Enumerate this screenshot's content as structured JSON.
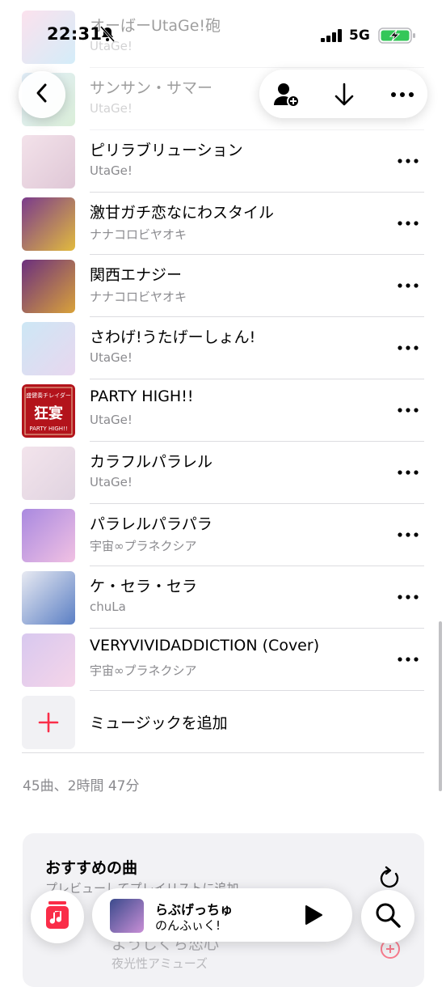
{
  "status": {
    "time": "22:31",
    "network": "5G",
    "icons": [
      "bell-slash-icon",
      "signal-icon",
      "battery-charging-icon"
    ]
  },
  "nav": {
    "back_icon": "chevron-left-icon",
    "actions": [
      "add-person-icon",
      "download-icon",
      "more-icon"
    ]
  },
  "songs": [
    {
      "title": "オーばーUtaGe!砲",
      "artist": "UtaGe!",
      "art": [
        "#f7b3d2",
        "#8fd0f0"
      ]
    },
    {
      "title": "サンサン・サマー",
      "artist": "UtaGe!",
      "art": [
        "#b8d8f5",
        "#9fd39b"
      ]
    },
    {
      "title": "ピリラブリューション",
      "artist": "UtaGe!",
      "art": [
        "#f3e2ea",
        "#dfc7d6"
      ]
    },
    {
      "title": "激甘ガチ恋なにわスタイル",
      "artist": "ナナコロビヤオキ",
      "art": [
        "#7a3a8c",
        "#e2bb3e"
      ]
    },
    {
      "title": "関西エナジー",
      "artist": "ナナコロビヤオキ",
      "art": [
        "#6b2f7e",
        "#d9a23a"
      ]
    },
    {
      "title": "さわげ!うたげーしょん!",
      "artist": "UtaGe!",
      "art": [
        "#cde7f5",
        "#e8d7ef"
      ]
    },
    {
      "title": "PARTY HIGH!!",
      "artist": "UtaGe!",
      "art": [
        "#b3131b",
        "#b3131b"
      ]
    },
    {
      "title": "カラフルパラレル",
      "artist": "UtaGe!",
      "art": [
        "#f3e4ec",
        "#e0d3e0"
      ]
    },
    {
      "title": "パラレルパラパラ",
      "artist": "宇宙∞プラネクシア",
      "art": [
        "#a989e0",
        "#f1c1e3"
      ]
    },
    {
      "title": "ケ・セラ・セラ",
      "artist": "chuLa",
      "art": [
        "#e8eaf2",
        "#5b7fc4"
      ]
    },
    {
      "title": "VERYVIVIDADDICTION (Cover)",
      "artist": "宇宙∞プラネクシア",
      "art": [
        "#d8c8ef",
        "#f5d5e9"
      ]
    }
  ],
  "party_art_text": {
    "top": "盛健奏チレイダー",
    "main": "狂宴",
    "sub": "PARTY HIGH!!"
  },
  "add_music": {
    "label": "ミュージックを追加"
  },
  "summary": "45曲、2時間 47分",
  "recommend": {
    "title": "おすすめの曲",
    "subtitle": "プレビューしてプレイリストに追加",
    "ghost_title": "ようじくち恋心",
    "ghost_artist": "夜光性アミューズ"
  },
  "player": {
    "title": "らぶげっちゅ",
    "artist": "のんふぃく!"
  },
  "colors": {
    "accent": "#fa2d48",
    "secondary_text": "#8a8a8e"
  }
}
